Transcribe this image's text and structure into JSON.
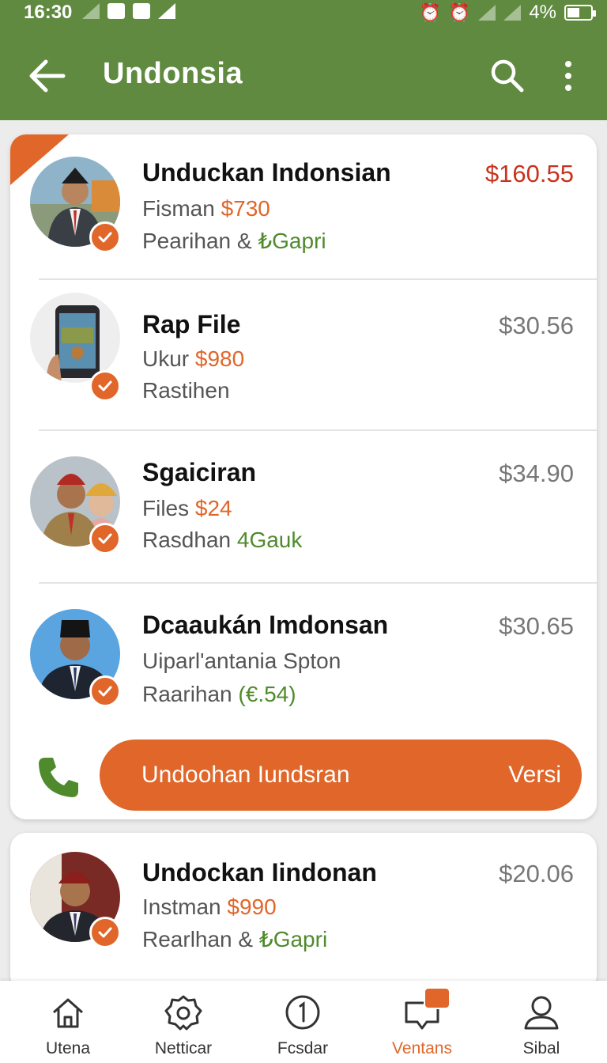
{
  "status_bar": {
    "time": "16:30",
    "battery": "4%"
  },
  "app_bar": {
    "title": "Undonsia"
  },
  "listings": [
    {
      "name": "Unduckan Indonsian",
      "line2_label": "Fisman",
      "line2_amount": "$730",
      "line3_label": "Pearihan &",
      "line3_extra": "₺Gapri",
      "price": "$160.55"
    },
    {
      "name": "Rap File",
      "line2_label": "Ukur",
      "line2_amount": "$980",
      "line3_label": "Rastihen",
      "line3_extra": "",
      "price": "$30.56"
    },
    {
      "name": "Sgaiciran",
      "line2_label": "Files",
      "line2_amount": "$24",
      "line3_label": "Rasdhan",
      "line3_extra": "4Gauk",
      "price": "$34.90"
    },
    {
      "name": "Dcaaukán Imdonsan",
      "line2_label": "Uiparl'antania Spton",
      "line2_amount": "",
      "line3_label": "Raarihan",
      "line3_extra": "(€.54)",
      "price": "$30.65"
    },
    {
      "name": "Undockan Iindonan",
      "line2_label": "Instman",
      "line2_amount": "$990",
      "line3_label": "Rearlhan &",
      "line3_extra": "₺Gapri",
      "price": "$20.06"
    }
  ],
  "cta": {
    "label": "Undoohan Iundsran",
    "right_label": "Versi"
  },
  "bottom_nav": [
    {
      "label": "Utena",
      "icon": "home-icon"
    },
    {
      "label": "Netticar",
      "icon": "gear-icon"
    },
    {
      "label": "Fcsdar",
      "icon": "info-icon"
    },
    {
      "label": "Ventans",
      "icon": "chat-icon",
      "active": true
    },
    {
      "label": "Sibal",
      "icon": "person-icon"
    }
  ],
  "colors": {
    "app_bar": "#5f8a3f",
    "accent": "#e0662a",
    "green_text": "#4f8a2c",
    "highlight_price": "#c8321e"
  }
}
